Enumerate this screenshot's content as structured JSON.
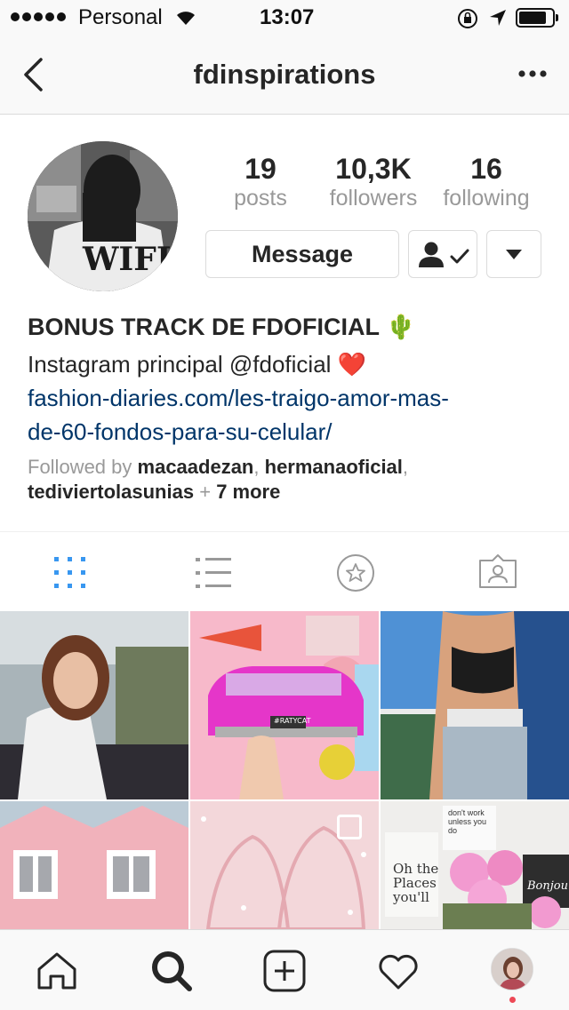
{
  "status_bar": {
    "carrier": "Personal",
    "time": "13:07"
  },
  "nav": {
    "title": "fdinspirations"
  },
  "avatar": {
    "shirt_text": "WIFI"
  },
  "stats": [
    {
      "value": "19",
      "label": "posts"
    },
    {
      "value": "10,3K",
      "label": "followers"
    },
    {
      "value": "16",
      "label": "following"
    }
  ],
  "actions": {
    "message_label": "Message"
  },
  "bio": {
    "name": "BONUS TRACK DE FDOFICIAL 🌵",
    "line": "Instagram principal @fdoficial ❤️",
    "link_line1": "fashion-diaries.com/les-traigo-amor-mas-",
    "link_line2": "de-60-fondos-para-su-celular/",
    "followed_prefix": "Followed by",
    "followed_user1": "macaadezan",
    "followed_sep1": ",",
    "followed_user2": "hermanaoficial",
    "followed_sep2": ",",
    "followed_user3": "tediviertolasunias",
    "followed_plus": "+",
    "followed_more": "7 more"
  },
  "grid": {
    "tile2_plate": "#RATYCAT",
    "tile6_text1": "Oh the",
    "tile6_text2": "Places",
    "tile6_text3": "you'll",
    "tile6_text4": "Bonjour",
    "tile6_text5": "don't work unless you do"
  },
  "colors": {
    "accent": "#3897f0",
    "link": "#003569",
    "notification": "#ed4956"
  }
}
